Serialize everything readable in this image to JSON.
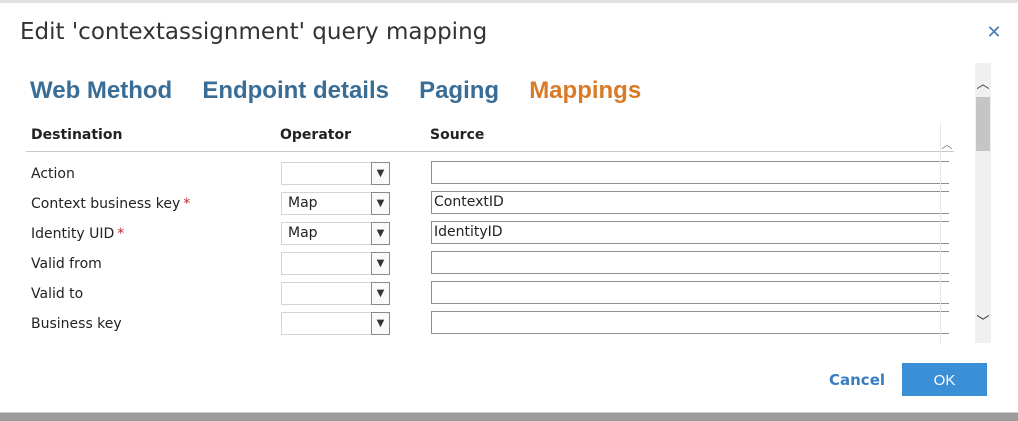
{
  "dialog": {
    "title": "Edit 'contextassignment' query mapping",
    "close_icon": "close-icon"
  },
  "tabs": [
    {
      "label": "Web Method",
      "active": false
    },
    {
      "label": "Endpoint details",
      "active": false
    },
    {
      "label": "Paging",
      "active": false
    },
    {
      "label": "Mappings",
      "active": true
    }
  ],
  "table": {
    "headers": {
      "destination": "Destination",
      "operator": "Operator",
      "source": "Source"
    },
    "rows": [
      {
        "destination": "Action",
        "required": false,
        "operator": "",
        "source": ""
      },
      {
        "destination": "Context business key",
        "required": true,
        "operator": "Map",
        "source": "ContextID"
      },
      {
        "destination": "Identity UID",
        "required": true,
        "operator": "Map",
        "source": "IdentityID"
      },
      {
        "destination": "Valid from",
        "required": false,
        "operator": "",
        "source": ""
      },
      {
        "destination": "Valid to",
        "required": false,
        "operator": "",
        "source": ""
      },
      {
        "destination": "Business key",
        "required": false,
        "operator": "",
        "source": ""
      }
    ]
  },
  "required_marker": "*",
  "footer": {
    "cancel_label": "Cancel",
    "ok_label": "OK"
  },
  "colors": {
    "tab": "#3a6d95",
    "tab_active": "#d97a26",
    "ok_button": "#3b8fd6",
    "required": "#c0282d"
  }
}
